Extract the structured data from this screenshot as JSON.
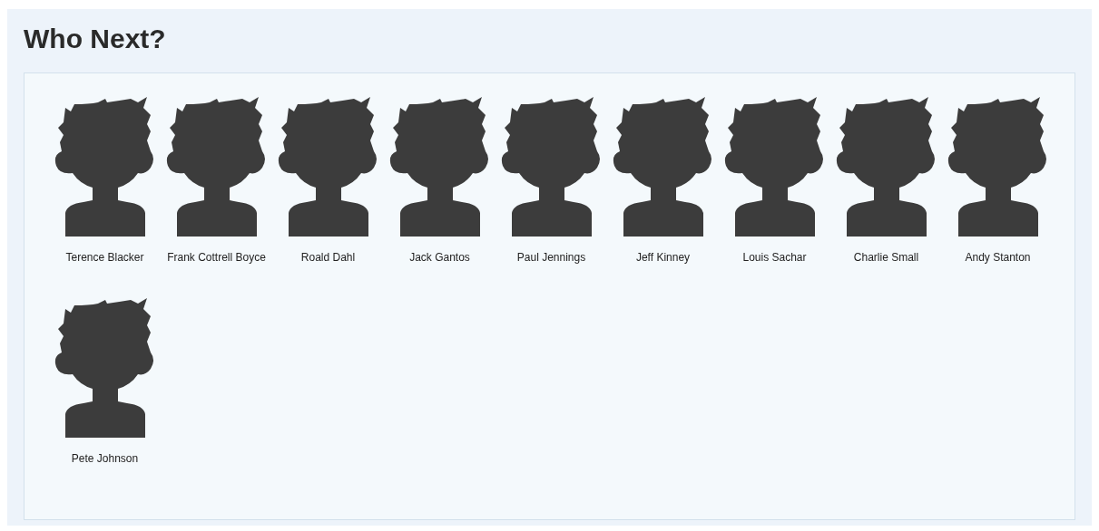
{
  "title": "Who Next?",
  "people": [
    {
      "name": "Terence Blacker"
    },
    {
      "name": "Frank Cottrell Boyce"
    },
    {
      "name": "Roald Dahl"
    },
    {
      "name": "Jack Gantos"
    },
    {
      "name": "Paul Jennings"
    },
    {
      "name": "Jeff Kinney"
    },
    {
      "name": "Louis Sachar"
    },
    {
      "name": "Charlie Small"
    },
    {
      "name": "Andy Stanton"
    },
    {
      "name": "Pete Johnson"
    }
  ]
}
